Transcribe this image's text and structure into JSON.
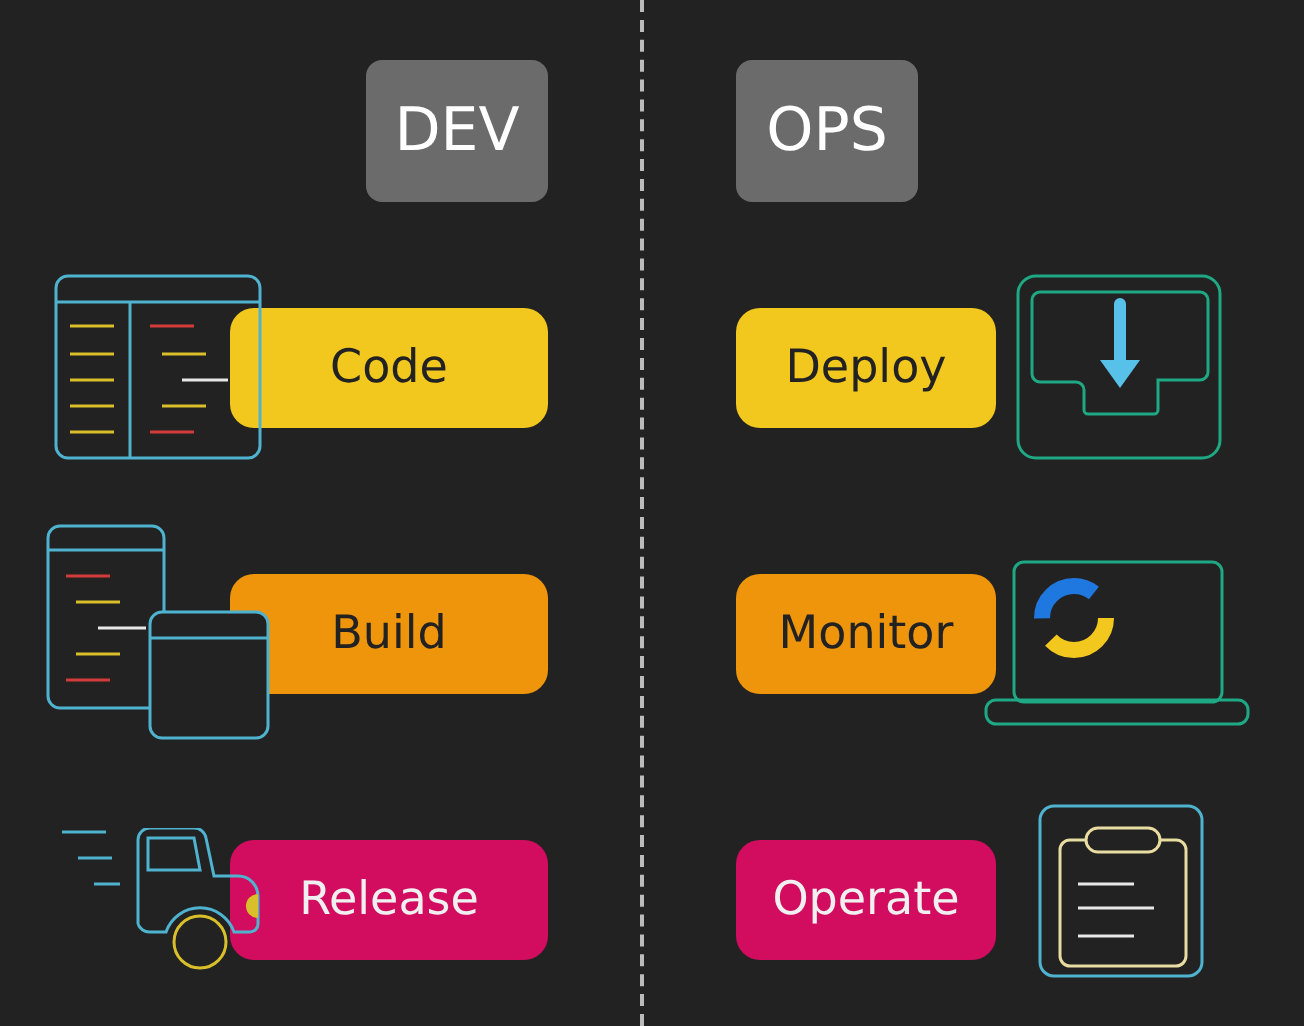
{
  "columns": [
    {
      "title": "DEV",
      "stages": [
        {
          "label": "Code",
          "kind": "code",
          "color": "#f3c81e"
        },
        {
          "label": "Build",
          "kind": "build",
          "color": "#ef950c"
        },
        {
          "label": "Release",
          "kind": "release",
          "color": "#d20c5e"
        }
      ]
    },
    {
      "title": "OPS",
      "stages": [
        {
          "label": "Deploy",
          "kind": "deploy",
          "color": "#f3c81e"
        },
        {
          "label": "Monitor",
          "kind": "monitor",
          "color": "#ef950c"
        },
        {
          "label": "Operate",
          "kind": "operate",
          "color": "#d20c5e"
        }
      ]
    }
  ]
}
